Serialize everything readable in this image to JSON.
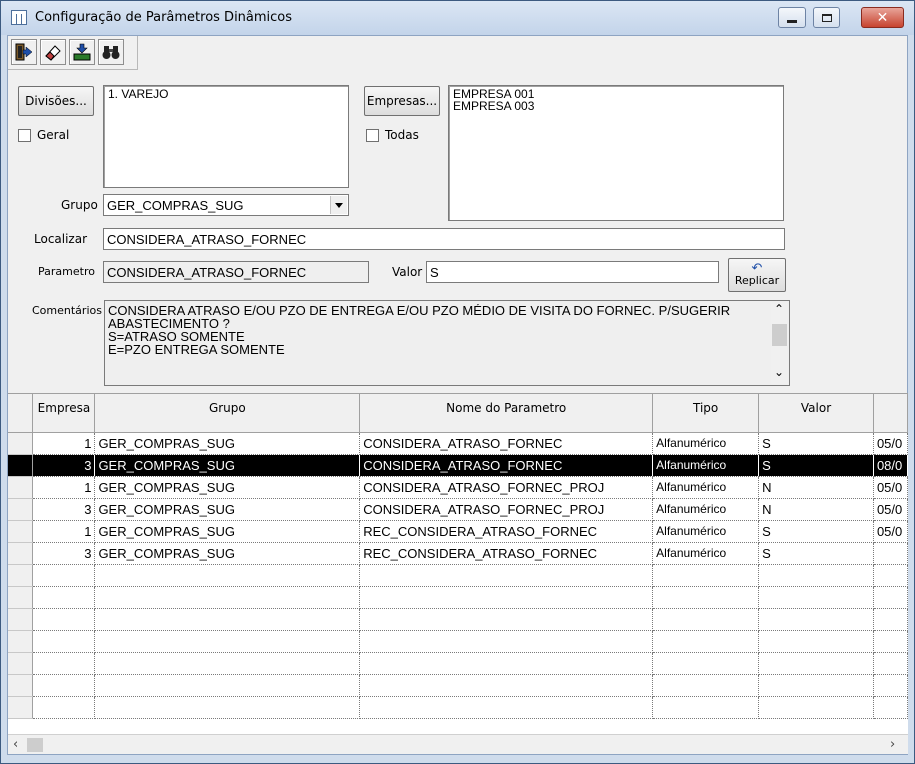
{
  "window": {
    "title": "Configuração de Parâmetros Dinâmicos"
  },
  "toolbar": {
    "icons": [
      "exit-icon",
      "eraser-icon",
      "save-to-tray-icon",
      "binoculars-icon"
    ]
  },
  "filters": {
    "divisoes_button": "Divisões...",
    "divisoes_items": [
      "1. VAREJO"
    ],
    "geral_label": "Geral",
    "empresas_button": "Empresas...",
    "empresas_items": [
      "EMPRESA 001",
      "EMPRESA 003"
    ],
    "todas_label": "Todas",
    "grupo_label": "Grupo",
    "grupo_value": "GER_COMPRAS_SUG",
    "localizar_label": "Localizar",
    "localizar_value": "CONSIDERA_ATRASO_FORNEC",
    "parametro_label": "Parametro",
    "parametro_value": "CONSIDERA_ATRASO_FORNEC",
    "valor_label": "Valor",
    "valor_value": "S",
    "replicar_label": "Replicar",
    "comentarios_label": "Comentários",
    "comentarios_lines": [
      "CONSIDERA ATRASO E/OU PZO DE ENTREGA E/OU PZO MÉDIO DE VISITA DO FORNEC. P/SUGERIR",
      "ABASTECIMENTO ?",
      "S=ATRASO SOMENTE",
      "E=PZO ENTREGA SOMENTE"
    ]
  },
  "grid": {
    "columns": [
      "Empresa",
      "Grupo",
      "Nome do Parametro",
      "Tipo",
      "Valor",
      ""
    ],
    "rows": [
      {
        "empresa": "1",
        "grupo": "GER_COMPRAS_SUG",
        "nome": "CONSIDERA_ATRASO_FORNEC",
        "tipo": "Alfanumérico",
        "valor": "S",
        "extra": "05/0"
      },
      {
        "empresa": "3",
        "grupo": "GER_COMPRAS_SUG",
        "nome": "CONSIDERA_ATRASO_FORNEC",
        "tipo": "Alfanumérico",
        "valor": "S",
        "extra": "08/0"
      },
      {
        "empresa": "1",
        "grupo": "GER_COMPRAS_SUG",
        "nome": "CONSIDERA_ATRASO_FORNEC_PROJ",
        "tipo": "Alfanumérico",
        "valor": "N",
        "extra": "05/0"
      },
      {
        "empresa": "3",
        "grupo": "GER_COMPRAS_SUG",
        "nome": "CONSIDERA_ATRASO_FORNEC_PROJ",
        "tipo": "Alfanumérico",
        "valor": "N",
        "extra": "05/0"
      },
      {
        "empresa": "1",
        "grupo": "GER_COMPRAS_SUG",
        "nome": "REC_CONSIDERA_ATRASO_FORNEC",
        "tipo": "Alfanumérico",
        "valor": "S",
        "extra": "05/0"
      },
      {
        "empresa": "3",
        "grupo": "GER_COMPRAS_SUG",
        "nome": "REC_CONSIDERA_ATRASO_FORNEC",
        "tipo": "Alfanumérico",
        "valor": "S",
        "extra": ""
      }
    ],
    "selected_row": 1,
    "empty_rows": 7
  },
  "scrollbar": {
    "left_arrow": "‹",
    "right_arrow": "›",
    "up_arrow": "^",
    "down_arrow": "v"
  }
}
